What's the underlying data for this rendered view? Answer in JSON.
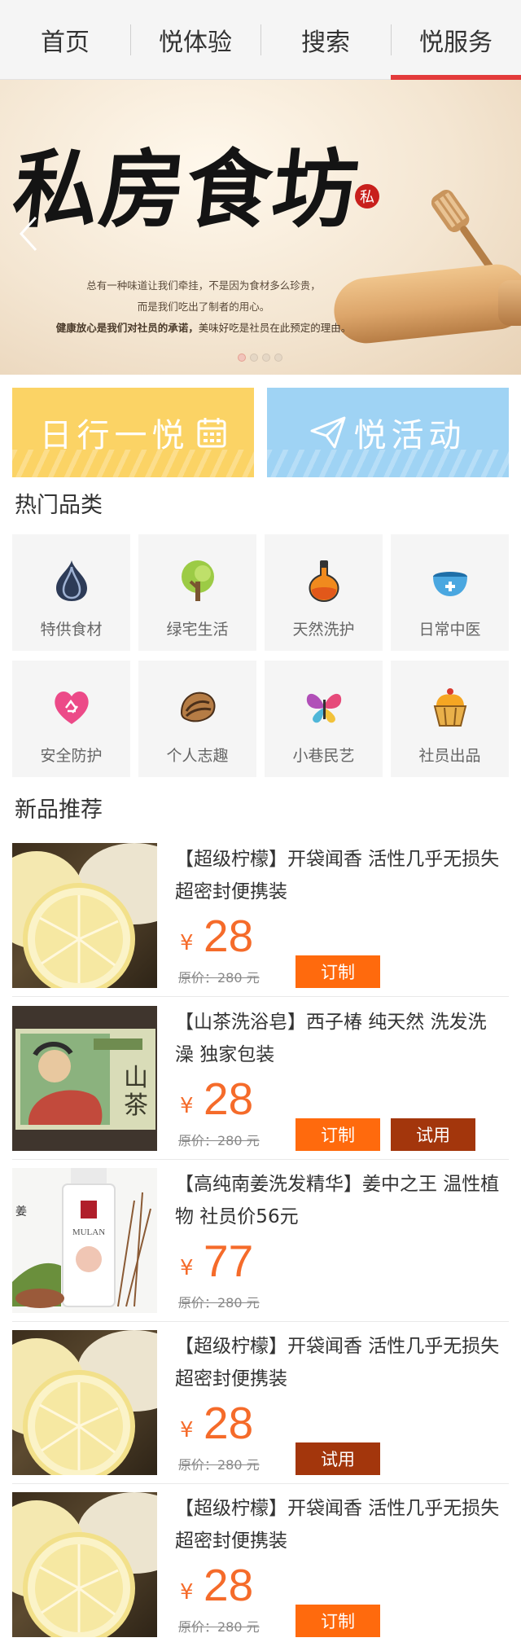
{
  "nav": {
    "tabs": [
      {
        "label": "首页",
        "active": false
      },
      {
        "label": "悦体验",
        "active": false
      },
      {
        "label": "搜索",
        "active": false
      },
      {
        "label": "悦服务",
        "active": true
      }
    ],
    "active_color": "#e33b3b"
  },
  "banner": {
    "title": "私房食坊",
    "seal": "私",
    "line1": "总有一种味道让我们牵挂，不是因为食材多么珍贵，",
    "line2": "而是我们吃出了制者的用心。",
    "line3_bold": "健康放心是我们对社员的承诺，",
    "line3_rest": "美味好吃是社员在此预定的理由。",
    "slide_count": 4,
    "active_slide": 1
  },
  "promos": [
    {
      "label": "日行一悦",
      "icon": "calendar-icon",
      "color": "#fbd365"
    },
    {
      "label": "悦活动",
      "icon": "paper-plane-icon",
      "color": "#9fd3f4"
    }
  ],
  "sections": {
    "hot": "热门品类",
    "new": "新品推荐"
  },
  "categories": [
    {
      "label": "特供食材",
      "icon": "garlic-icon"
    },
    {
      "label": "绿宅生活",
      "icon": "tree-icon"
    },
    {
      "label": "天然洗护",
      "icon": "oil-bottle-icon"
    },
    {
      "label": "日常中医",
      "icon": "medicine-bowl-icon"
    },
    {
      "label": "安全防护",
      "icon": "recycle-heart-icon"
    },
    {
      "label": "个人志趣",
      "icon": "shell-icon"
    },
    {
      "label": "小巷民艺",
      "icon": "butterfly-icon"
    },
    {
      "label": "社员出品",
      "icon": "cupcake-icon"
    }
  ],
  "products": [
    {
      "title": "【超级柠檬】开袋闻香 活性几乎无损失 超密封便携装",
      "currency": "¥",
      "price": "28",
      "orig": "原价：280 元",
      "buttons": [
        "订制"
      ]
    },
    {
      "title": "【山茶洗浴皂】西子椿 纯天然 洗发洗澡 独家包装",
      "currency": "¥",
      "price": "28",
      "orig": "原价：280 元",
      "buttons": [
        "订制",
        "试用"
      ]
    },
    {
      "title": "【高纯南姜洗发精华】姜中之王 温性植物 社员价56元",
      "currency": "¥",
      "price": "77",
      "orig": "原价：280 元",
      "buttons": []
    },
    {
      "title": "【超级柠檬】开袋闻香 活性几乎无损失 超密封便携装",
      "currency": "¥",
      "price": "28",
      "orig": "原价：280 元",
      "buttons": [
        "试用"
      ]
    },
    {
      "title": "【超级柠檬】开袋闻香 活性几乎无损失 超密封便携装",
      "currency": "¥",
      "price": "28",
      "orig": "原价：280 元",
      "buttons": [
        "订制"
      ]
    }
  ],
  "image_text": {
    "soap_char1": "山",
    "soap_char2": "茶",
    "ginger_brand": "MULAN",
    "ginger_side": "姜"
  },
  "colors": {
    "price": "#f56b2a",
    "order_button": "#ff6a0d",
    "trial_button": "#a3360c"
  }
}
